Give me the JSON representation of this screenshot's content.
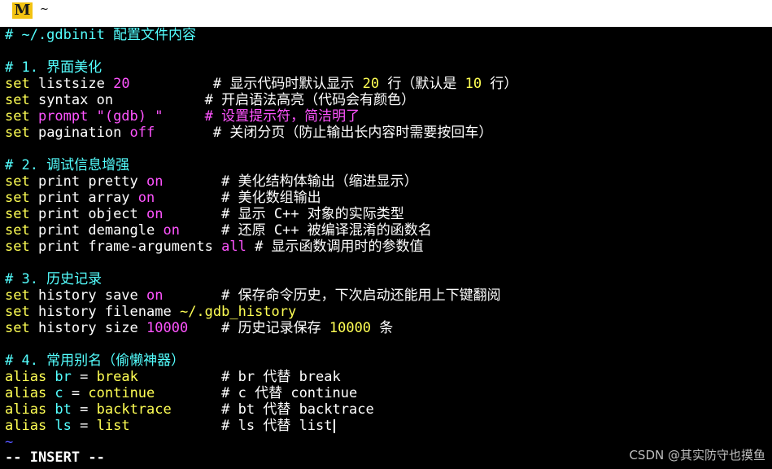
{
  "window": {
    "title": "~",
    "app_logo_letter": "M"
  },
  "lines": [
    [
      {
        "t": "# ~/.gdbinit 配置文件内容",
        "c": "head"
      }
    ],
    [],
    [
      {
        "t": "# 1. 界面美化",
        "c": "head"
      }
    ],
    [
      {
        "t": "set",
        "c": "kw"
      },
      {
        "t": " listsize ",
        "c": "com"
      },
      {
        "t": "20",
        "c": "val"
      },
      {
        "t": "          # 显示代码时默认显示 ",
        "c": "com"
      },
      {
        "t": "20",
        "c": "kw"
      },
      {
        "t": " 行（默认是 ",
        "c": "com"
      },
      {
        "t": "10",
        "c": "kw"
      },
      {
        "t": " 行）",
        "c": "com"
      }
    ],
    [
      {
        "t": "set",
        "c": "kw"
      },
      {
        "t": " syntax on           # 开启语法高亮（代码会有颜色）",
        "c": "com"
      }
    ],
    [
      {
        "t": "set",
        "c": "kw"
      },
      {
        "t": " prompt \"(gdb) \"     # 设置提示符，简洁明了",
        "c": "val"
      }
    ],
    [
      {
        "t": "set",
        "c": "kw"
      },
      {
        "t": " pagination ",
        "c": "com"
      },
      {
        "t": "off",
        "c": "val"
      },
      {
        "t": "       # 关闭分页（防止输出长内容时需要按回车）",
        "c": "com"
      }
    ],
    [],
    [
      {
        "t": "# 2. 调试信息增强",
        "c": "head"
      }
    ],
    [
      {
        "t": "set",
        "c": "kw"
      },
      {
        "t": " print pretty ",
        "c": "com"
      },
      {
        "t": "on",
        "c": "val"
      },
      {
        "t": "       # 美化结构体输出（缩进显示）",
        "c": "com"
      }
    ],
    [
      {
        "t": "set",
        "c": "kw"
      },
      {
        "t": " print array ",
        "c": "com"
      },
      {
        "t": "on",
        "c": "val"
      },
      {
        "t": "        # 美化数组输出",
        "c": "com"
      }
    ],
    [
      {
        "t": "set",
        "c": "kw"
      },
      {
        "t": " print object ",
        "c": "com"
      },
      {
        "t": "on",
        "c": "val"
      },
      {
        "t": "       # 显示 C++ 对象的实际类型",
        "c": "com"
      }
    ],
    [
      {
        "t": "set",
        "c": "kw"
      },
      {
        "t": " print demangle ",
        "c": "com"
      },
      {
        "t": "on",
        "c": "val"
      },
      {
        "t": "     # 还原 C++ 被编译混淆的函数名",
        "c": "com"
      }
    ],
    [
      {
        "t": "set",
        "c": "kw"
      },
      {
        "t": " print frame-arguments ",
        "c": "com"
      },
      {
        "t": "all",
        "c": "val"
      },
      {
        "t": " # 显示函数调用时的参数值",
        "c": "com"
      }
    ],
    [],
    [
      {
        "t": "# 3. 历史记录",
        "c": "head"
      }
    ],
    [
      {
        "t": "set",
        "c": "kw"
      },
      {
        "t": " history save ",
        "c": "com"
      },
      {
        "t": "on",
        "c": "val"
      },
      {
        "t": "       # 保存命令历史，下次启动还能用上下键翻阅",
        "c": "com"
      }
    ],
    [
      {
        "t": "set",
        "c": "kw"
      },
      {
        "t": " history filename ",
        "c": "com"
      },
      {
        "t": "~/.gdb_history",
        "c": "kw"
      }
    ],
    [
      {
        "t": "set",
        "c": "kw"
      },
      {
        "t": " history size ",
        "c": "com"
      },
      {
        "t": "10000",
        "c": "val"
      },
      {
        "t": "    # 历史记录保存 ",
        "c": "com"
      },
      {
        "t": "10000",
        "c": "kw"
      },
      {
        "t": " 条",
        "c": "com"
      }
    ],
    [],
    [
      {
        "t": "# 4. 常用别名（偷懒神器）",
        "c": "head"
      }
    ],
    [
      {
        "t": "alias",
        "c": "kw"
      },
      {
        "t": " br ",
        "c": "head"
      },
      {
        "t": "= ",
        "c": "com"
      },
      {
        "t": "break",
        "c": "kw"
      },
      {
        "t": "          # br 代替 break",
        "c": "com"
      }
    ],
    [
      {
        "t": "alias",
        "c": "kw"
      },
      {
        "t": " c ",
        "c": "head"
      },
      {
        "t": "= ",
        "c": "com"
      },
      {
        "t": "continue",
        "c": "kw"
      },
      {
        "t": "        # c 代替 continue",
        "c": "com"
      }
    ],
    [
      {
        "t": "alias",
        "c": "kw"
      },
      {
        "t": " bt ",
        "c": "head"
      },
      {
        "t": "= ",
        "c": "com"
      },
      {
        "t": "backtrace",
        "c": "kw"
      },
      {
        "t": "      # bt 代替 backtrace",
        "c": "com"
      }
    ],
    [
      {
        "t": "alias",
        "c": "kw"
      },
      {
        "t": " ls ",
        "c": "head"
      },
      {
        "t": "= ",
        "c": "com"
      },
      {
        "t": "list",
        "c": "kw"
      },
      {
        "t": "           # ls 代替 list",
        "c": "com"
      }
    ],
    [
      {
        "t": "~",
        "c": "tilde"
      }
    ]
  ],
  "status_line": "-- INSERT --",
  "watermark": "CSDN @其实防守也摸鱼"
}
